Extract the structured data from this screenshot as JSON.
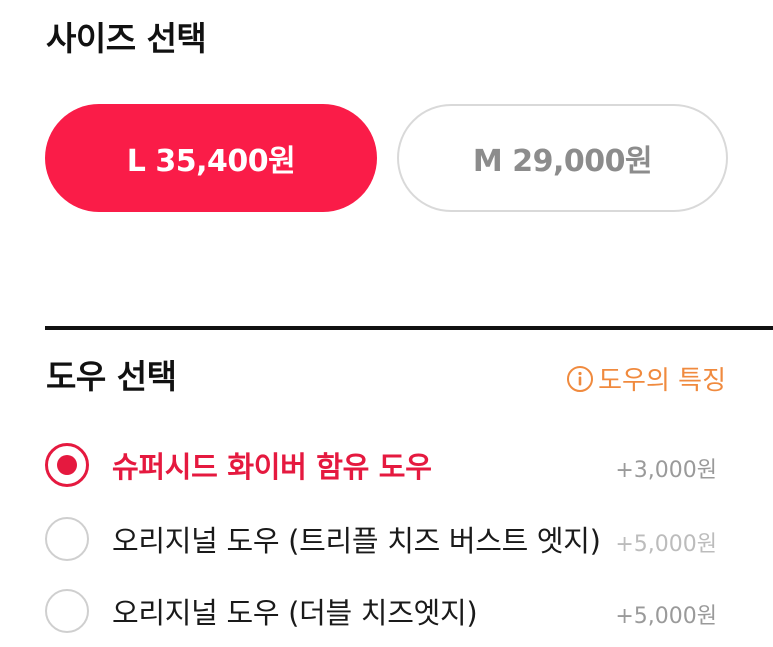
{
  "size_section": {
    "title": "사이즈 선택",
    "options": [
      {
        "label": "L 35,400원",
        "selected": true
      },
      {
        "label": "M 29,000원",
        "selected": false
      }
    ]
  },
  "dough_section": {
    "title": "도우 선택",
    "info_link": {
      "label": "도우의 특징",
      "icon": "info-icon"
    },
    "options": [
      {
        "label": "슈퍼시드 화이버 함유 도우",
        "price": "+3,000원",
        "selected": true
      },
      {
        "label": "오리지널 도우 (트리플 치즈 버스트 엣지)",
        "price": "+5,000원",
        "selected": false
      },
      {
        "label": "오리지널 도우 (더블 치즈엣지)",
        "price": "+5,000원",
        "selected": false
      }
    ]
  },
  "colors": {
    "accent": "#fa1c48",
    "selected_text": "#e5193f",
    "info_link": "#f08a3e",
    "muted": "#8c8c8c"
  }
}
